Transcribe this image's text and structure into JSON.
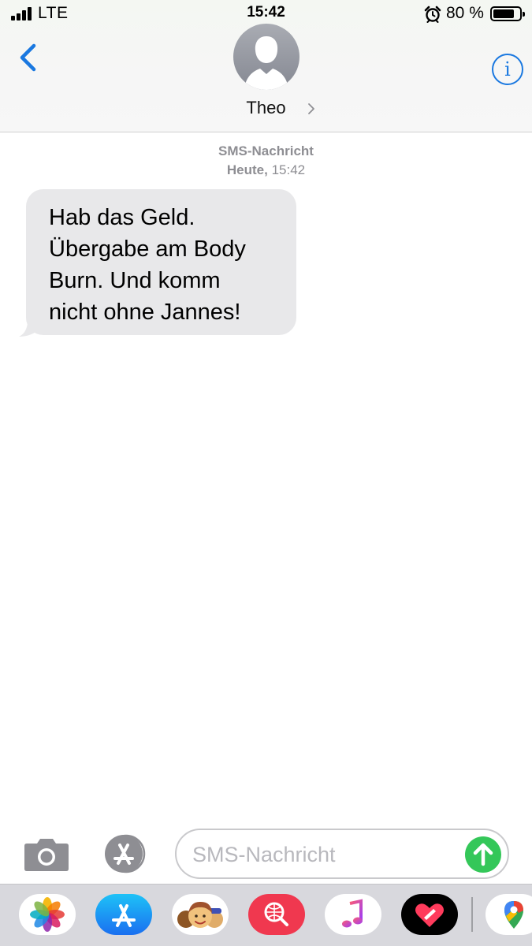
{
  "status_bar": {
    "carrier": "LTE",
    "time": "15:42",
    "battery_percent": "80 %",
    "battery_level": 0.8
  },
  "header": {
    "contact_name": "Theo",
    "info_label": "i",
    "icons": [
      "chevron-left-icon",
      "person-placeholder-icon",
      "chevron-right-icon",
      "info-icon"
    ]
  },
  "conversation": {
    "service_label": "SMS-Nachricht",
    "date_label": "Heute,",
    "time_label": "15:42",
    "messages": [
      {
        "direction": "incoming",
        "lines": [
          "Hab das Geld.",
          "Übergabe am Body",
          "Burn. Und komm",
          "nicht ohne Jannes!"
        ]
      }
    ]
  },
  "input_bar": {
    "placeholder": "SMS-Nachricht",
    "value": "",
    "icons": [
      "camera-icon",
      "app-store-icon",
      "send-arrow-icon"
    ]
  },
  "app_drawer": {
    "apps": [
      "photos",
      "app-store",
      "memoji",
      "search-images",
      "music",
      "digital-touch",
      "maps"
    ]
  },
  "colors": {
    "accent": "#1a78e0",
    "send": "#34c759",
    "bubble_incoming": "#e8e8ea",
    "meta_text": "#8e8e93"
  }
}
